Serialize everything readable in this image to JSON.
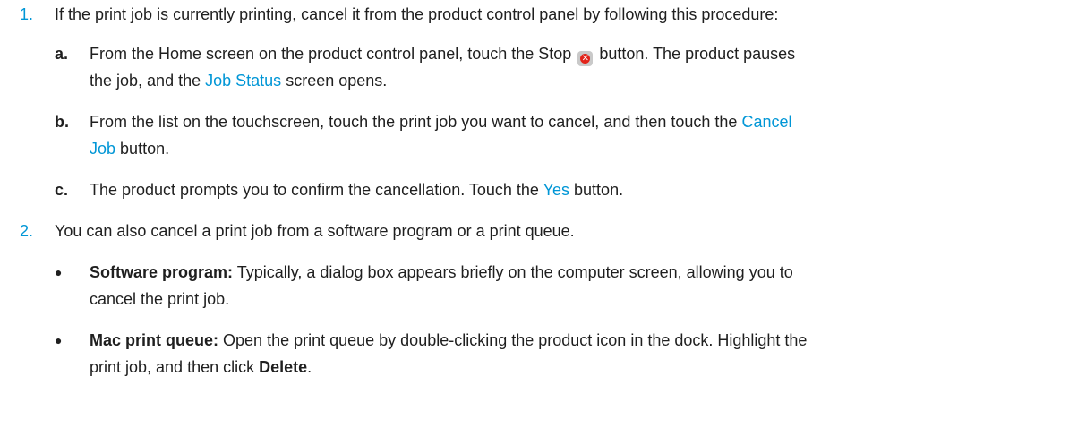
{
  "steps": [
    {
      "number": "1.",
      "text": "If the print job is currently printing, cancel it from the product control panel by following this procedure:",
      "substeps": [
        {
          "letter": "a.",
          "text_before": "From the Home screen on the product control panel, touch the Stop",
          "text_mid": "button. The product pauses",
          "text_line2_before": "the job, and the",
          "link": "Job Status",
          "text_line2_after": "screen opens."
        },
        {
          "letter": "b.",
          "text_before": "From the list on the touchscreen, touch the print job you want to cancel, and then touch the",
          "link_part1": "Cancel",
          "link_part2": "Job",
          "text_after": "button."
        },
        {
          "letter": "c.",
          "text_before": "The product prompts you to confirm the cancellation. Touch the",
          "link": "Yes",
          "text_after": "button."
        }
      ]
    },
    {
      "number": "2.",
      "text": "You can also cancel a print job from a software program or a print queue.",
      "bullets": [
        {
          "bullet": "●",
          "label": "Software program:",
          "line1": "Typically, a dialog box appears briefly on the computer screen, allowing you to",
          "line2": "cancel the print job."
        },
        {
          "bullet": "●",
          "label": "Mac print queue:",
          "line1": "Open the print queue by double-clicking the product icon in the dock. Highlight the",
          "line2_before": "print job, and then click",
          "line2_bold": "Delete",
          "line2_after": "."
        }
      ]
    }
  ],
  "icons": {
    "stop": "stop-icon",
    "stop_glyph": "✕"
  },
  "colors": {
    "accent": "#0096d6",
    "stop_red": "#e2231a",
    "text": "#1f1f1f"
  }
}
